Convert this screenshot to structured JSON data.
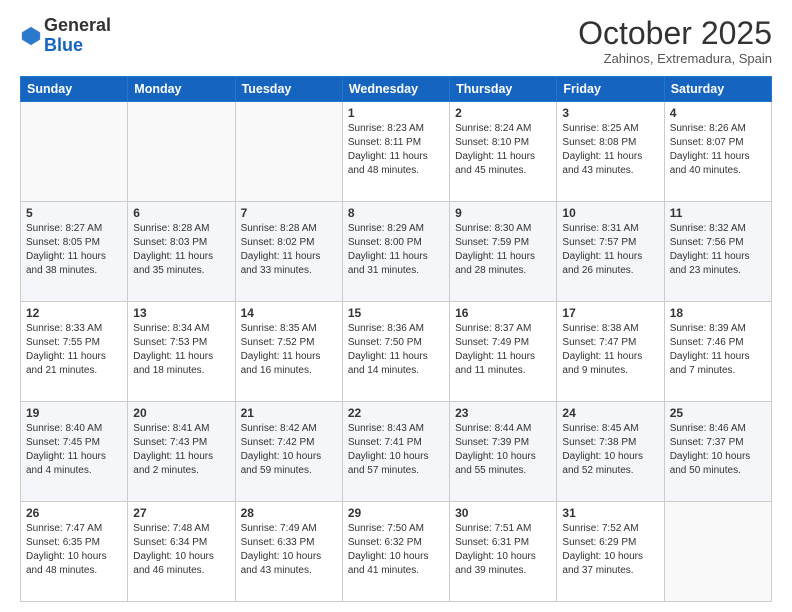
{
  "header": {
    "logo": {
      "line1": "General",
      "line2": "Blue"
    },
    "title": "October 2025",
    "subtitle": "Zahinos, Extremadura, Spain"
  },
  "weekdays": [
    "Sunday",
    "Monday",
    "Tuesday",
    "Wednesday",
    "Thursday",
    "Friday",
    "Saturday"
  ],
  "weeks": [
    [
      {
        "day": "",
        "sunrise": "",
        "sunset": "",
        "daylight": ""
      },
      {
        "day": "",
        "sunrise": "",
        "sunset": "",
        "daylight": ""
      },
      {
        "day": "",
        "sunrise": "",
        "sunset": "",
        "daylight": ""
      },
      {
        "day": "1",
        "sunrise": "8:23 AM",
        "sunset": "8:11 PM",
        "daylight": "11 hours and 48 minutes."
      },
      {
        "day": "2",
        "sunrise": "8:24 AM",
        "sunset": "8:10 PM",
        "daylight": "11 hours and 45 minutes."
      },
      {
        "day": "3",
        "sunrise": "8:25 AM",
        "sunset": "8:08 PM",
        "daylight": "11 hours and 43 minutes."
      },
      {
        "day": "4",
        "sunrise": "8:26 AM",
        "sunset": "8:07 PM",
        "daylight": "11 hours and 40 minutes."
      }
    ],
    [
      {
        "day": "5",
        "sunrise": "8:27 AM",
        "sunset": "8:05 PM",
        "daylight": "11 hours and 38 minutes."
      },
      {
        "day": "6",
        "sunrise": "8:28 AM",
        "sunset": "8:03 PM",
        "daylight": "11 hours and 35 minutes."
      },
      {
        "day": "7",
        "sunrise": "8:28 AM",
        "sunset": "8:02 PM",
        "daylight": "11 hours and 33 minutes."
      },
      {
        "day": "8",
        "sunrise": "8:29 AM",
        "sunset": "8:00 PM",
        "daylight": "11 hours and 31 minutes."
      },
      {
        "day": "9",
        "sunrise": "8:30 AM",
        "sunset": "7:59 PM",
        "daylight": "11 hours and 28 minutes."
      },
      {
        "day": "10",
        "sunrise": "8:31 AM",
        "sunset": "7:57 PM",
        "daylight": "11 hours and 26 minutes."
      },
      {
        "day": "11",
        "sunrise": "8:32 AM",
        "sunset": "7:56 PM",
        "daylight": "11 hours and 23 minutes."
      }
    ],
    [
      {
        "day": "12",
        "sunrise": "8:33 AM",
        "sunset": "7:55 PM",
        "daylight": "11 hours and 21 minutes."
      },
      {
        "day": "13",
        "sunrise": "8:34 AM",
        "sunset": "7:53 PM",
        "daylight": "11 hours and 18 minutes."
      },
      {
        "day": "14",
        "sunrise": "8:35 AM",
        "sunset": "7:52 PM",
        "daylight": "11 hours and 16 minutes."
      },
      {
        "day": "15",
        "sunrise": "8:36 AM",
        "sunset": "7:50 PM",
        "daylight": "11 hours and 14 minutes."
      },
      {
        "day": "16",
        "sunrise": "8:37 AM",
        "sunset": "7:49 PM",
        "daylight": "11 hours and 11 minutes."
      },
      {
        "day": "17",
        "sunrise": "8:38 AM",
        "sunset": "7:47 PM",
        "daylight": "11 hours and 9 minutes."
      },
      {
        "day": "18",
        "sunrise": "8:39 AM",
        "sunset": "7:46 PM",
        "daylight": "11 hours and 7 minutes."
      }
    ],
    [
      {
        "day": "19",
        "sunrise": "8:40 AM",
        "sunset": "7:45 PM",
        "daylight": "11 hours and 4 minutes."
      },
      {
        "day": "20",
        "sunrise": "8:41 AM",
        "sunset": "7:43 PM",
        "daylight": "11 hours and 2 minutes."
      },
      {
        "day": "21",
        "sunrise": "8:42 AM",
        "sunset": "7:42 PM",
        "daylight": "10 hours and 59 minutes."
      },
      {
        "day": "22",
        "sunrise": "8:43 AM",
        "sunset": "7:41 PM",
        "daylight": "10 hours and 57 minutes."
      },
      {
        "day": "23",
        "sunrise": "8:44 AM",
        "sunset": "7:39 PM",
        "daylight": "10 hours and 55 minutes."
      },
      {
        "day": "24",
        "sunrise": "8:45 AM",
        "sunset": "7:38 PM",
        "daylight": "10 hours and 52 minutes."
      },
      {
        "day": "25",
        "sunrise": "8:46 AM",
        "sunset": "7:37 PM",
        "daylight": "10 hours and 50 minutes."
      }
    ],
    [
      {
        "day": "26",
        "sunrise": "7:47 AM",
        "sunset": "6:35 PM",
        "daylight": "10 hours and 48 minutes."
      },
      {
        "day": "27",
        "sunrise": "7:48 AM",
        "sunset": "6:34 PM",
        "daylight": "10 hours and 46 minutes."
      },
      {
        "day": "28",
        "sunrise": "7:49 AM",
        "sunset": "6:33 PM",
        "daylight": "10 hours and 43 minutes."
      },
      {
        "day": "29",
        "sunrise": "7:50 AM",
        "sunset": "6:32 PM",
        "daylight": "10 hours and 41 minutes."
      },
      {
        "day": "30",
        "sunrise": "7:51 AM",
        "sunset": "6:31 PM",
        "daylight": "10 hours and 39 minutes."
      },
      {
        "day": "31",
        "sunrise": "7:52 AM",
        "sunset": "6:29 PM",
        "daylight": "10 hours and 37 minutes."
      },
      {
        "day": "",
        "sunrise": "",
        "sunset": "",
        "daylight": ""
      }
    ]
  ],
  "labels": {
    "sunrise_prefix": "Sunrise: ",
    "sunset_prefix": "Sunset: ",
    "daylight_prefix": "Daylight: "
  }
}
